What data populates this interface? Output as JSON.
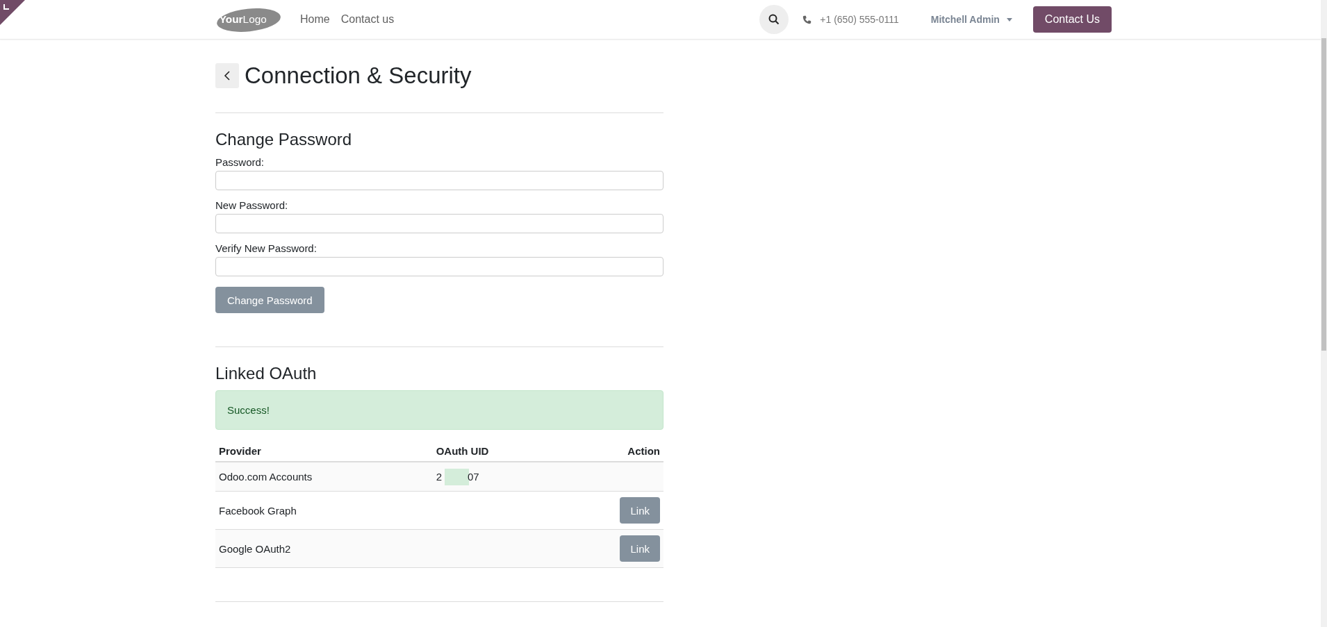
{
  "header": {
    "logo": {
      "bold": "Your",
      "light": "Logo"
    },
    "nav": [
      {
        "label": "Home"
      },
      {
        "label": "Contact us"
      }
    ],
    "phone": "+1 (650) 555-0111",
    "user": "Mitchell Admin",
    "cta": "Contact Us"
  },
  "page": {
    "title": "Connection & Security"
  },
  "change_password": {
    "heading": "Change Password",
    "fields": [
      {
        "label": "Password:"
      },
      {
        "label": "New Password:"
      },
      {
        "label": "Verify New Password:"
      }
    ],
    "button": "Change Password"
  },
  "oauth": {
    "heading": "Linked OAuth",
    "alert": "Success!",
    "columns": [
      "Provider",
      "OAuth UID",
      "Action"
    ],
    "rows": [
      {
        "provider": "Odoo.com Accounts",
        "uid_parts": [
          "2",
          "07"
        ]
      },
      {
        "provider": "Facebook Graph",
        "action": "Link"
      },
      {
        "provider": "Google OAuth2",
        "action": "Link"
      }
    ]
  }
}
